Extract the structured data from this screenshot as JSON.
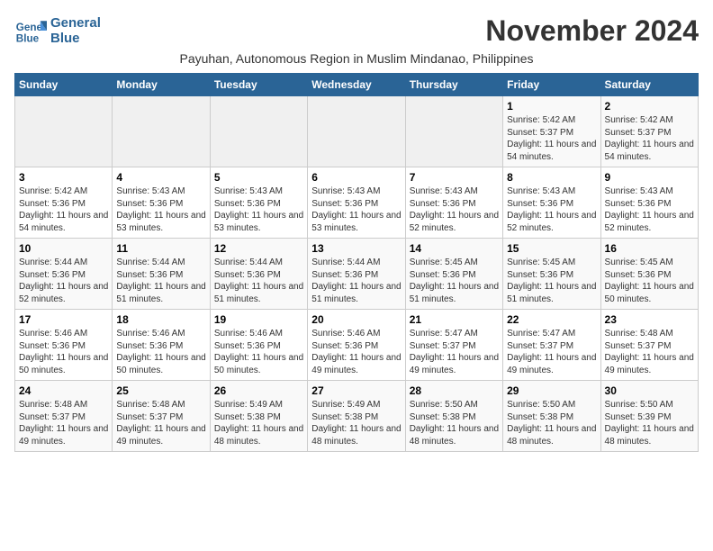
{
  "header": {
    "logo_line1": "General",
    "logo_line2": "Blue",
    "month_title": "November 2024",
    "subtitle": "Payuhan, Autonomous Region in Muslim Mindanao, Philippines"
  },
  "weekdays": [
    "Sunday",
    "Monday",
    "Tuesday",
    "Wednesday",
    "Thursday",
    "Friday",
    "Saturday"
  ],
  "weeks": [
    [
      {
        "day": "",
        "info": ""
      },
      {
        "day": "",
        "info": ""
      },
      {
        "day": "",
        "info": ""
      },
      {
        "day": "",
        "info": ""
      },
      {
        "day": "",
        "info": ""
      },
      {
        "day": "1",
        "info": "Sunrise: 5:42 AM\nSunset: 5:37 PM\nDaylight: 11 hours and 54 minutes."
      },
      {
        "day": "2",
        "info": "Sunrise: 5:42 AM\nSunset: 5:37 PM\nDaylight: 11 hours and 54 minutes."
      }
    ],
    [
      {
        "day": "3",
        "info": "Sunrise: 5:42 AM\nSunset: 5:36 PM\nDaylight: 11 hours and 54 minutes."
      },
      {
        "day": "4",
        "info": "Sunrise: 5:43 AM\nSunset: 5:36 PM\nDaylight: 11 hours and 53 minutes."
      },
      {
        "day": "5",
        "info": "Sunrise: 5:43 AM\nSunset: 5:36 PM\nDaylight: 11 hours and 53 minutes."
      },
      {
        "day": "6",
        "info": "Sunrise: 5:43 AM\nSunset: 5:36 PM\nDaylight: 11 hours and 53 minutes."
      },
      {
        "day": "7",
        "info": "Sunrise: 5:43 AM\nSunset: 5:36 PM\nDaylight: 11 hours and 52 minutes."
      },
      {
        "day": "8",
        "info": "Sunrise: 5:43 AM\nSunset: 5:36 PM\nDaylight: 11 hours and 52 minutes."
      },
      {
        "day": "9",
        "info": "Sunrise: 5:43 AM\nSunset: 5:36 PM\nDaylight: 11 hours and 52 minutes."
      }
    ],
    [
      {
        "day": "10",
        "info": "Sunrise: 5:44 AM\nSunset: 5:36 PM\nDaylight: 11 hours and 52 minutes."
      },
      {
        "day": "11",
        "info": "Sunrise: 5:44 AM\nSunset: 5:36 PM\nDaylight: 11 hours and 51 minutes."
      },
      {
        "day": "12",
        "info": "Sunrise: 5:44 AM\nSunset: 5:36 PM\nDaylight: 11 hours and 51 minutes."
      },
      {
        "day": "13",
        "info": "Sunrise: 5:44 AM\nSunset: 5:36 PM\nDaylight: 11 hours and 51 minutes."
      },
      {
        "day": "14",
        "info": "Sunrise: 5:45 AM\nSunset: 5:36 PM\nDaylight: 11 hours and 51 minutes."
      },
      {
        "day": "15",
        "info": "Sunrise: 5:45 AM\nSunset: 5:36 PM\nDaylight: 11 hours and 51 minutes."
      },
      {
        "day": "16",
        "info": "Sunrise: 5:45 AM\nSunset: 5:36 PM\nDaylight: 11 hours and 50 minutes."
      }
    ],
    [
      {
        "day": "17",
        "info": "Sunrise: 5:46 AM\nSunset: 5:36 PM\nDaylight: 11 hours and 50 minutes."
      },
      {
        "day": "18",
        "info": "Sunrise: 5:46 AM\nSunset: 5:36 PM\nDaylight: 11 hours and 50 minutes."
      },
      {
        "day": "19",
        "info": "Sunrise: 5:46 AM\nSunset: 5:36 PM\nDaylight: 11 hours and 50 minutes."
      },
      {
        "day": "20",
        "info": "Sunrise: 5:46 AM\nSunset: 5:36 PM\nDaylight: 11 hours and 49 minutes."
      },
      {
        "day": "21",
        "info": "Sunrise: 5:47 AM\nSunset: 5:37 PM\nDaylight: 11 hours and 49 minutes."
      },
      {
        "day": "22",
        "info": "Sunrise: 5:47 AM\nSunset: 5:37 PM\nDaylight: 11 hours and 49 minutes."
      },
      {
        "day": "23",
        "info": "Sunrise: 5:48 AM\nSunset: 5:37 PM\nDaylight: 11 hours and 49 minutes."
      }
    ],
    [
      {
        "day": "24",
        "info": "Sunrise: 5:48 AM\nSunset: 5:37 PM\nDaylight: 11 hours and 49 minutes."
      },
      {
        "day": "25",
        "info": "Sunrise: 5:48 AM\nSunset: 5:37 PM\nDaylight: 11 hours and 49 minutes."
      },
      {
        "day": "26",
        "info": "Sunrise: 5:49 AM\nSunset: 5:38 PM\nDaylight: 11 hours and 48 minutes."
      },
      {
        "day": "27",
        "info": "Sunrise: 5:49 AM\nSunset: 5:38 PM\nDaylight: 11 hours and 48 minutes."
      },
      {
        "day": "28",
        "info": "Sunrise: 5:50 AM\nSunset: 5:38 PM\nDaylight: 11 hours and 48 minutes."
      },
      {
        "day": "29",
        "info": "Sunrise: 5:50 AM\nSunset: 5:38 PM\nDaylight: 11 hours and 48 minutes."
      },
      {
        "day": "30",
        "info": "Sunrise: 5:50 AM\nSunset: 5:39 PM\nDaylight: 11 hours and 48 minutes."
      }
    ]
  ]
}
